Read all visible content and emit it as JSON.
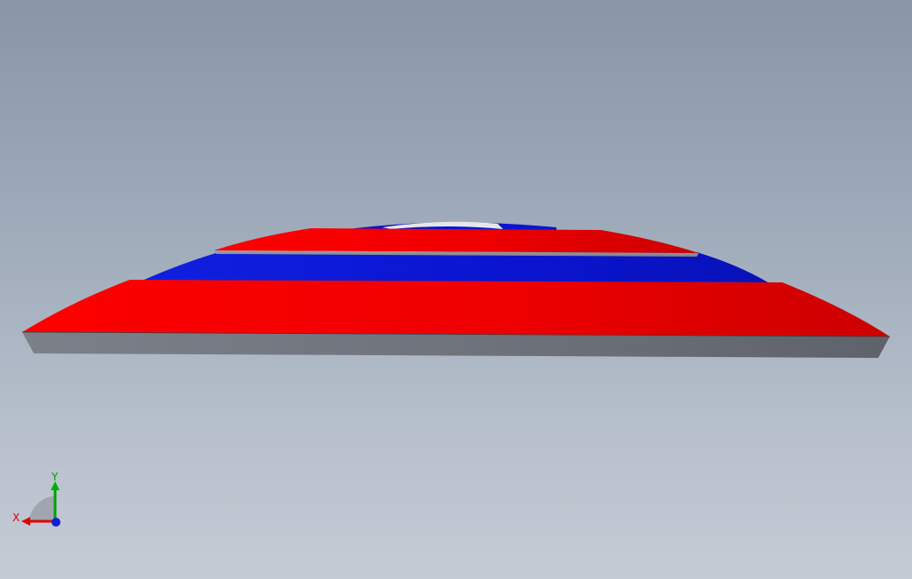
{
  "viewport": {
    "background_top": "#8896a8",
    "background_bottom": "#c4cbd5"
  },
  "model": {
    "layers": [
      {
        "name": "base-plate",
        "face_color": "#ef0000",
        "side_color": "#6f737c"
      },
      {
        "name": "middle-band",
        "face_color": "#0a14cf"
      },
      {
        "name": "upper-band",
        "face_color": "#ee0000",
        "side_color": "#8a8d93"
      },
      {
        "name": "top-cap",
        "face_color": "#0a14cf",
        "highlight_color": "#e6e6ea"
      }
    ]
  },
  "triad": {
    "x_label": "X",
    "y_label": "Y",
    "x_color": "#e00000",
    "y_color": "#00a000",
    "z_color": "#1020d0"
  }
}
